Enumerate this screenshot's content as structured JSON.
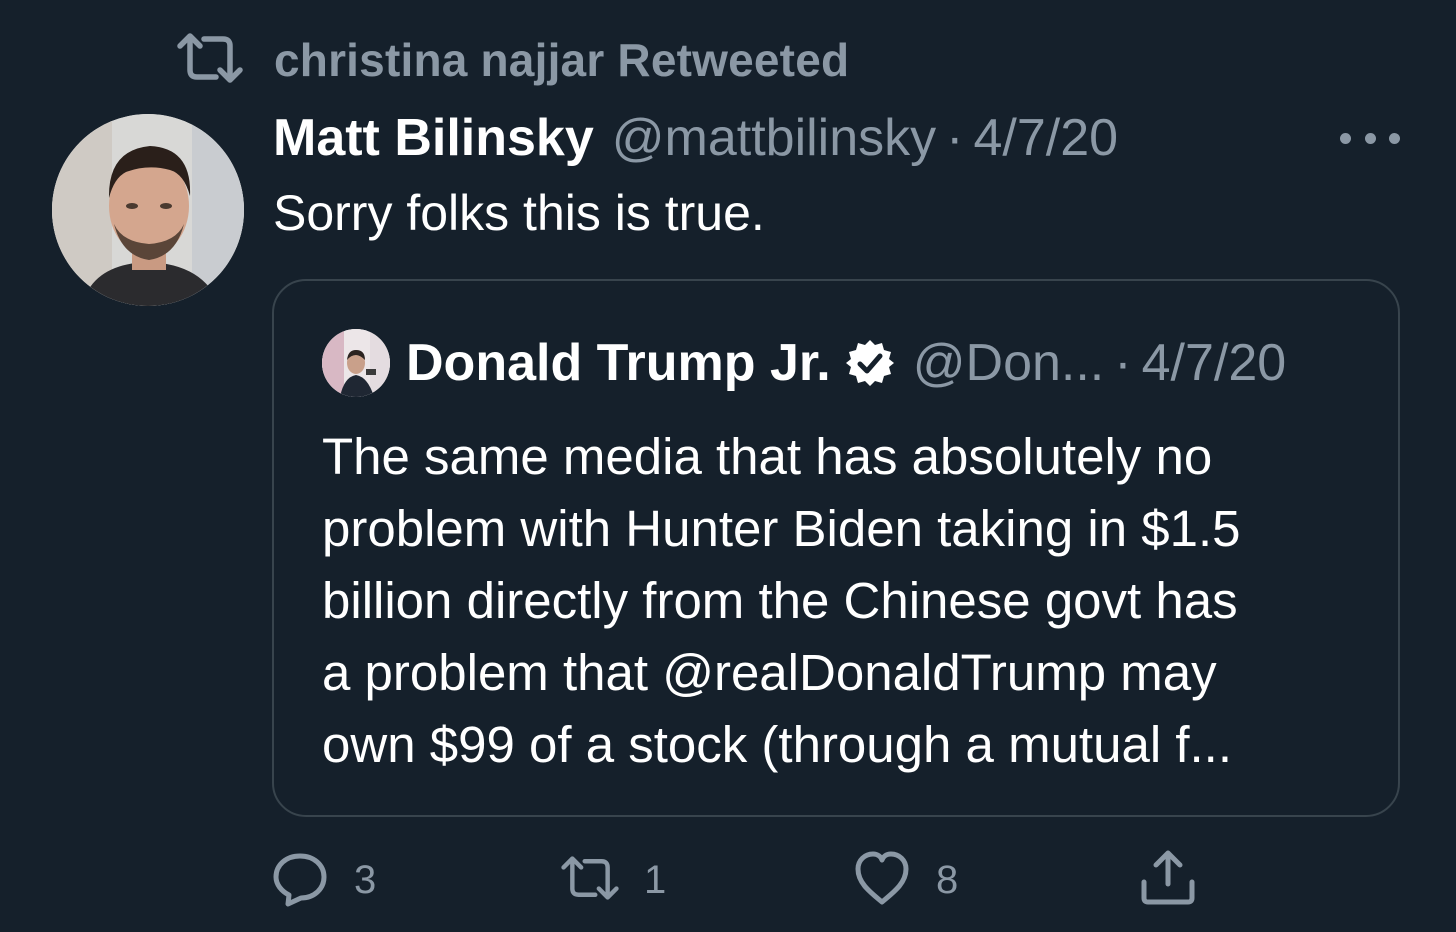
{
  "retweet": {
    "icon": "retweet-icon",
    "label": "christina najjar Retweeted"
  },
  "tweet": {
    "author_name": "Matt Bilinsky",
    "author_handle": "@mattbilinsky",
    "separator": "·",
    "date": "4/7/20",
    "text": "Sorry folks this is true.",
    "more_icon": "more-horizontal-icon"
  },
  "quote": {
    "author_name": "Donald Trump Jr.",
    "verified_icon": "verified-badge-icon",
    "author_handle": "@Don...",
    "separator": "·",
    "date": "4/7/20",
    "text_lines": [
      "The same media that has absolutely no",
      "problem with Hunter Biden taking in $1.5",
      "billion directly from the Chinese govt has",
      "a problem that @realDonaldTrump may",
      "own $99 of a stock (through a mutual f..."
    ]
  },
  "actions": {
    "reply": {
      "icon": "reply-icon",
      "count": "3"
    },
    "retweet": {
      "icon": "retweet-icon",
      "count": "1"
    },
    "like": {
      "icon": "heart-icon",
      "count": "8"
    },
    "share": {
      "icon": "share-icon",
      "count": ""
    }
  },
  "colors": {
    "background": "#15202b",
    "secondary_text": "#8b98a5",
    "border": "#38444d",
    "primary_text": "#ffffff"
  }
}
